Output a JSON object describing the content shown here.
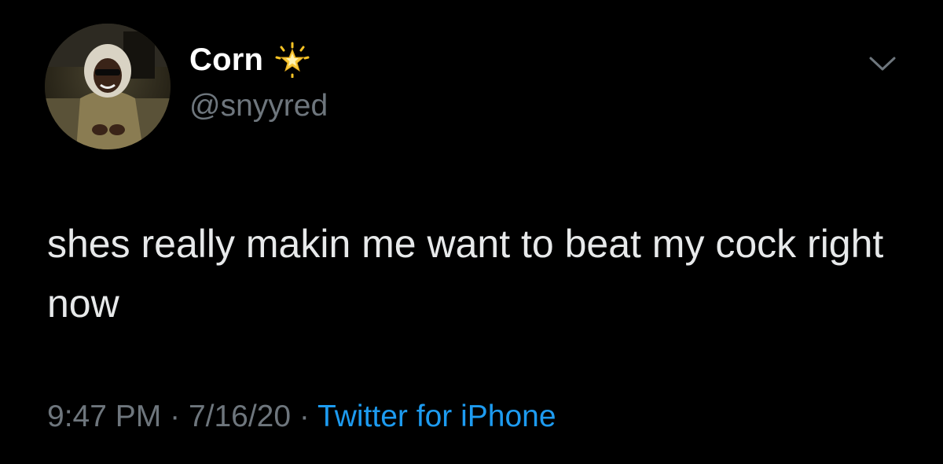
{
  "user": {
    "display_name": "Corn",
    "handle": "@snyyred",
    "badge_icon": "glowing-star-emoji",
    "avatar_icon": "profile-photo"
  },
  "menu": {
    "icon": "chevron-down-icon"
  },
  "tweet": {
    "text": "shes really makin me want to beat my cock right now",
    "time": "9:47 PM",
    "separator": "·",
    "date": "7/16/20",
    "source": "Twitter for iPhone"
  },
  "colors": {
    "background": "#000000",
    "text": "#e7e9ea",
    "secondary": "#6e767d",
    "link": "#1d9bf0"
  }
}
